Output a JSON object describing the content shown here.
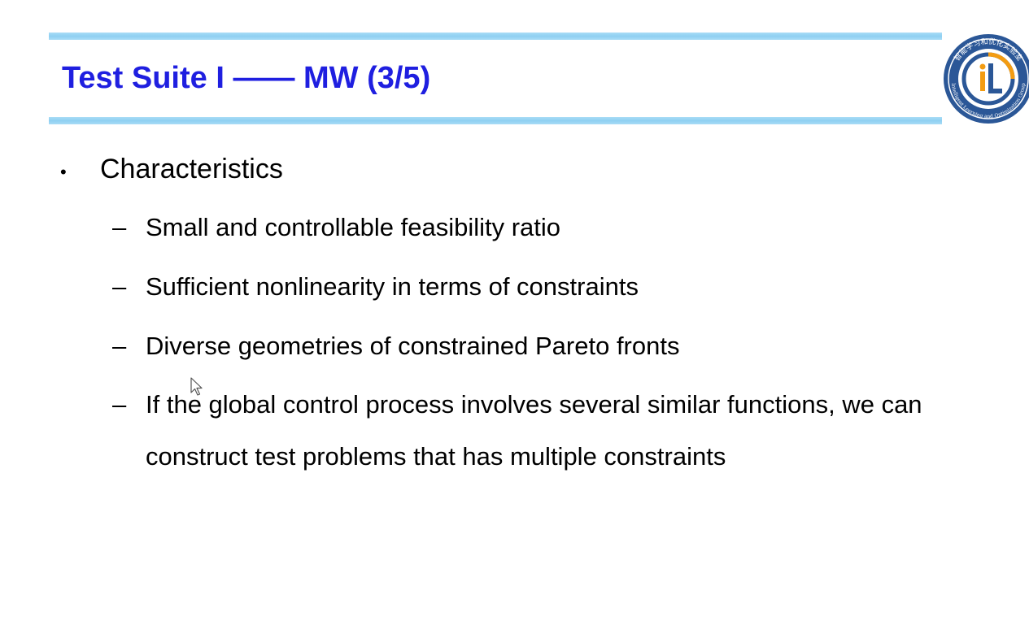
{
  "slide": {
    "title": "Test Suite I —— MW (3/5)",
    "colors": {
      "title": "#1f1fe0",
      "rule": "#8fd0f2",
      "logo_ring": "#2b5797",
      "logo_accent": "#f39c12"
    },
    "logo": {
      "top_text": "智能学习和优化实验室",
      "bottom_text": "Intelligent Learning and Optimization Group",
      "mark": "iL"
    },
    "bullet": {
      "label": "Characteristics",
      "items": [
        "Small and controllable feasibility ratio",
        "Sufficient nonlinearity in terms of constraints",
        "Diverse geometries of constrained Pareto fronts",
        "If the global control process involves several similar functions, we can construct test problems that has multiple constraints"
      ]
    },
    "symbols": {
      "bullet": "•",
      "dash": "–"
    }
  }
}
